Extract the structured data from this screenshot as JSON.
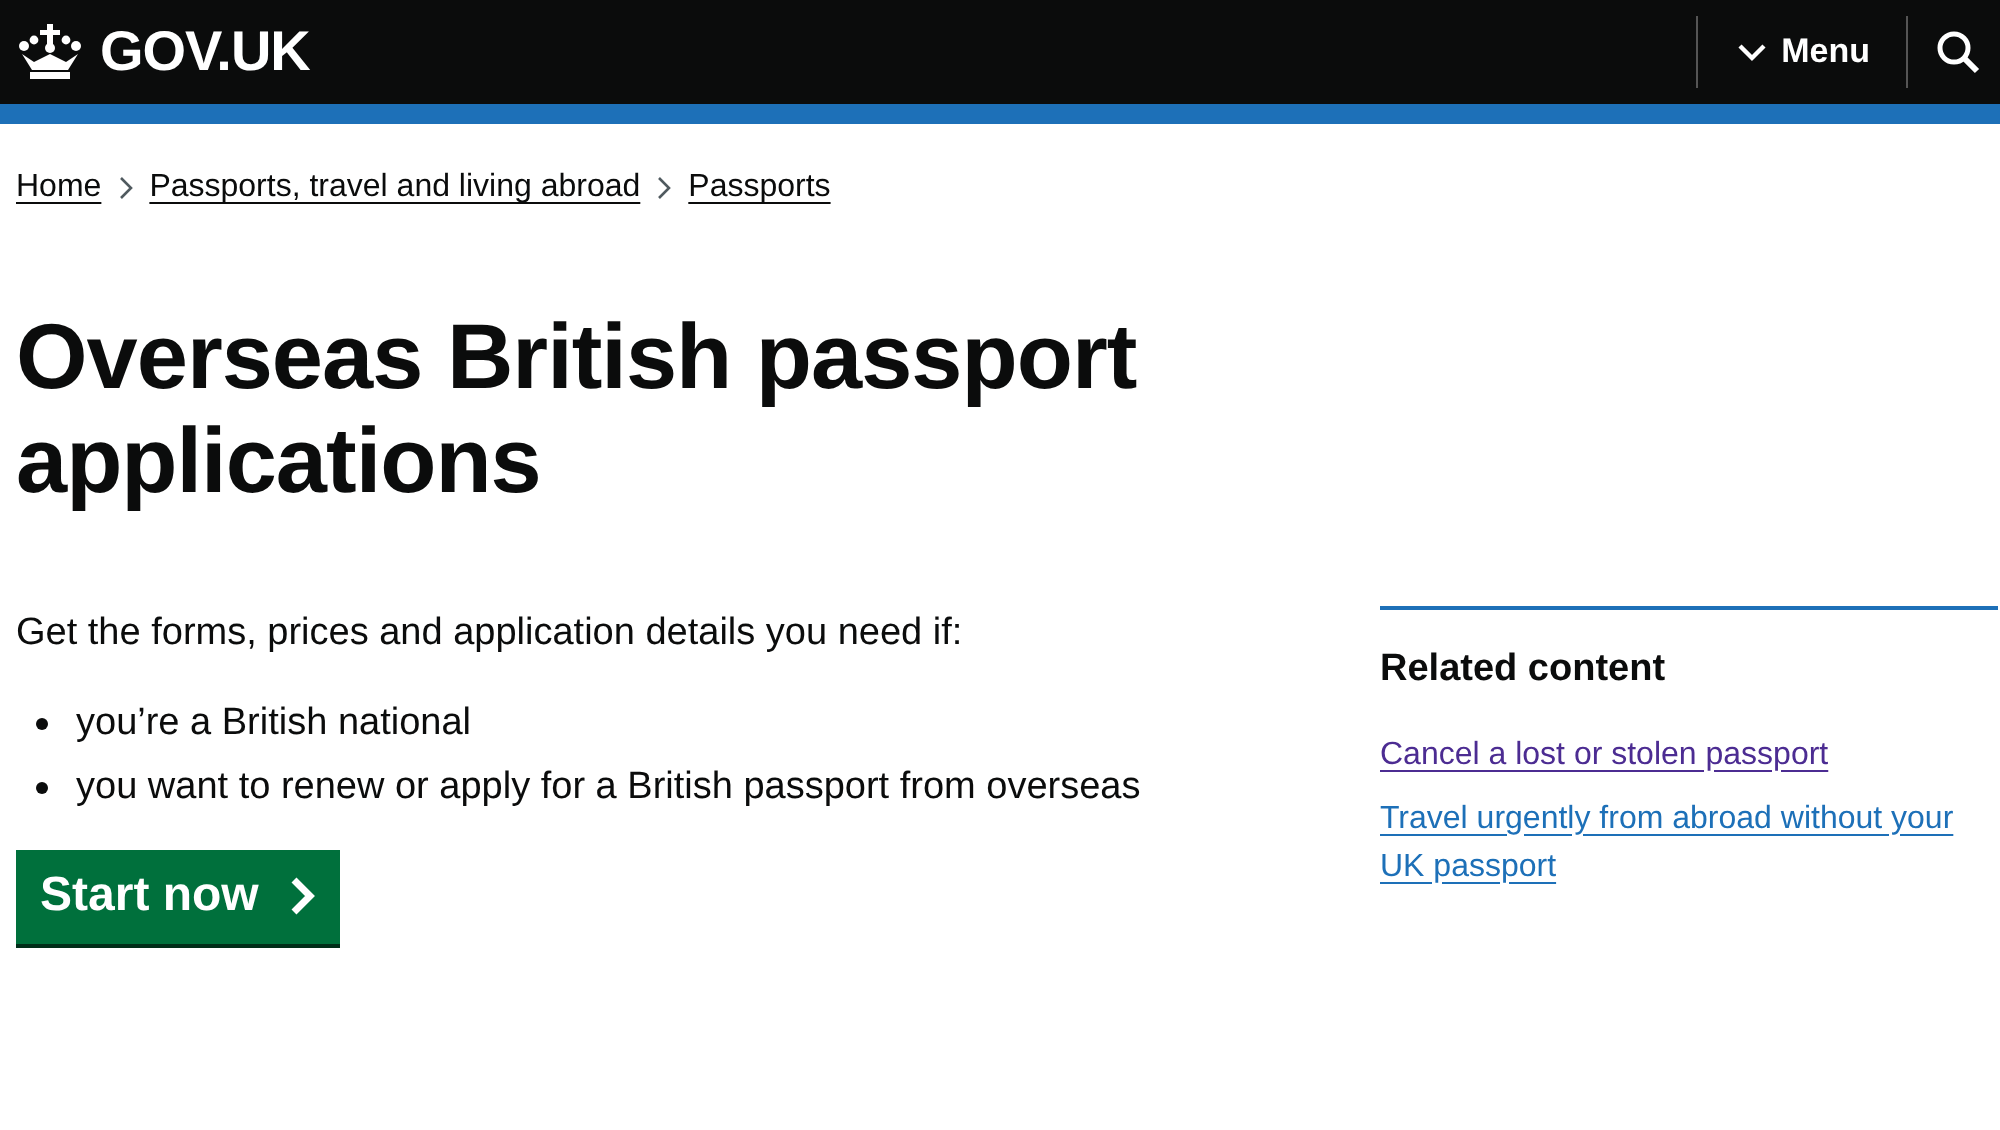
{
  "header": {
    "logo": "GOV.UK",
    "menu": "Menu"
  },
  "breadcrumbs": [
    {
      "label": "Home"
    },
    {
      "label": "Passports, travel and living abroad"
    },
    {
      "label": "Passports"
    }
  ],
  "title": "Overseas British passport applications",
  "intro": "Get the forms, prices and application details you need if:",
  "bullets": [
    "you’re a British national",
    "you want to renew or apply for a British passport from overseas"
  ],
  "start_button": "Start now",
  "related": {
    "heading": "Related content",
    "links": [
      {
        "label": "Cancel a lost or stolen passport",
        "visited": true
      },
      {
        "label": "Travel urgently from abroad without your UK passport",
        "visited": false
      }
    ]
  }
}
